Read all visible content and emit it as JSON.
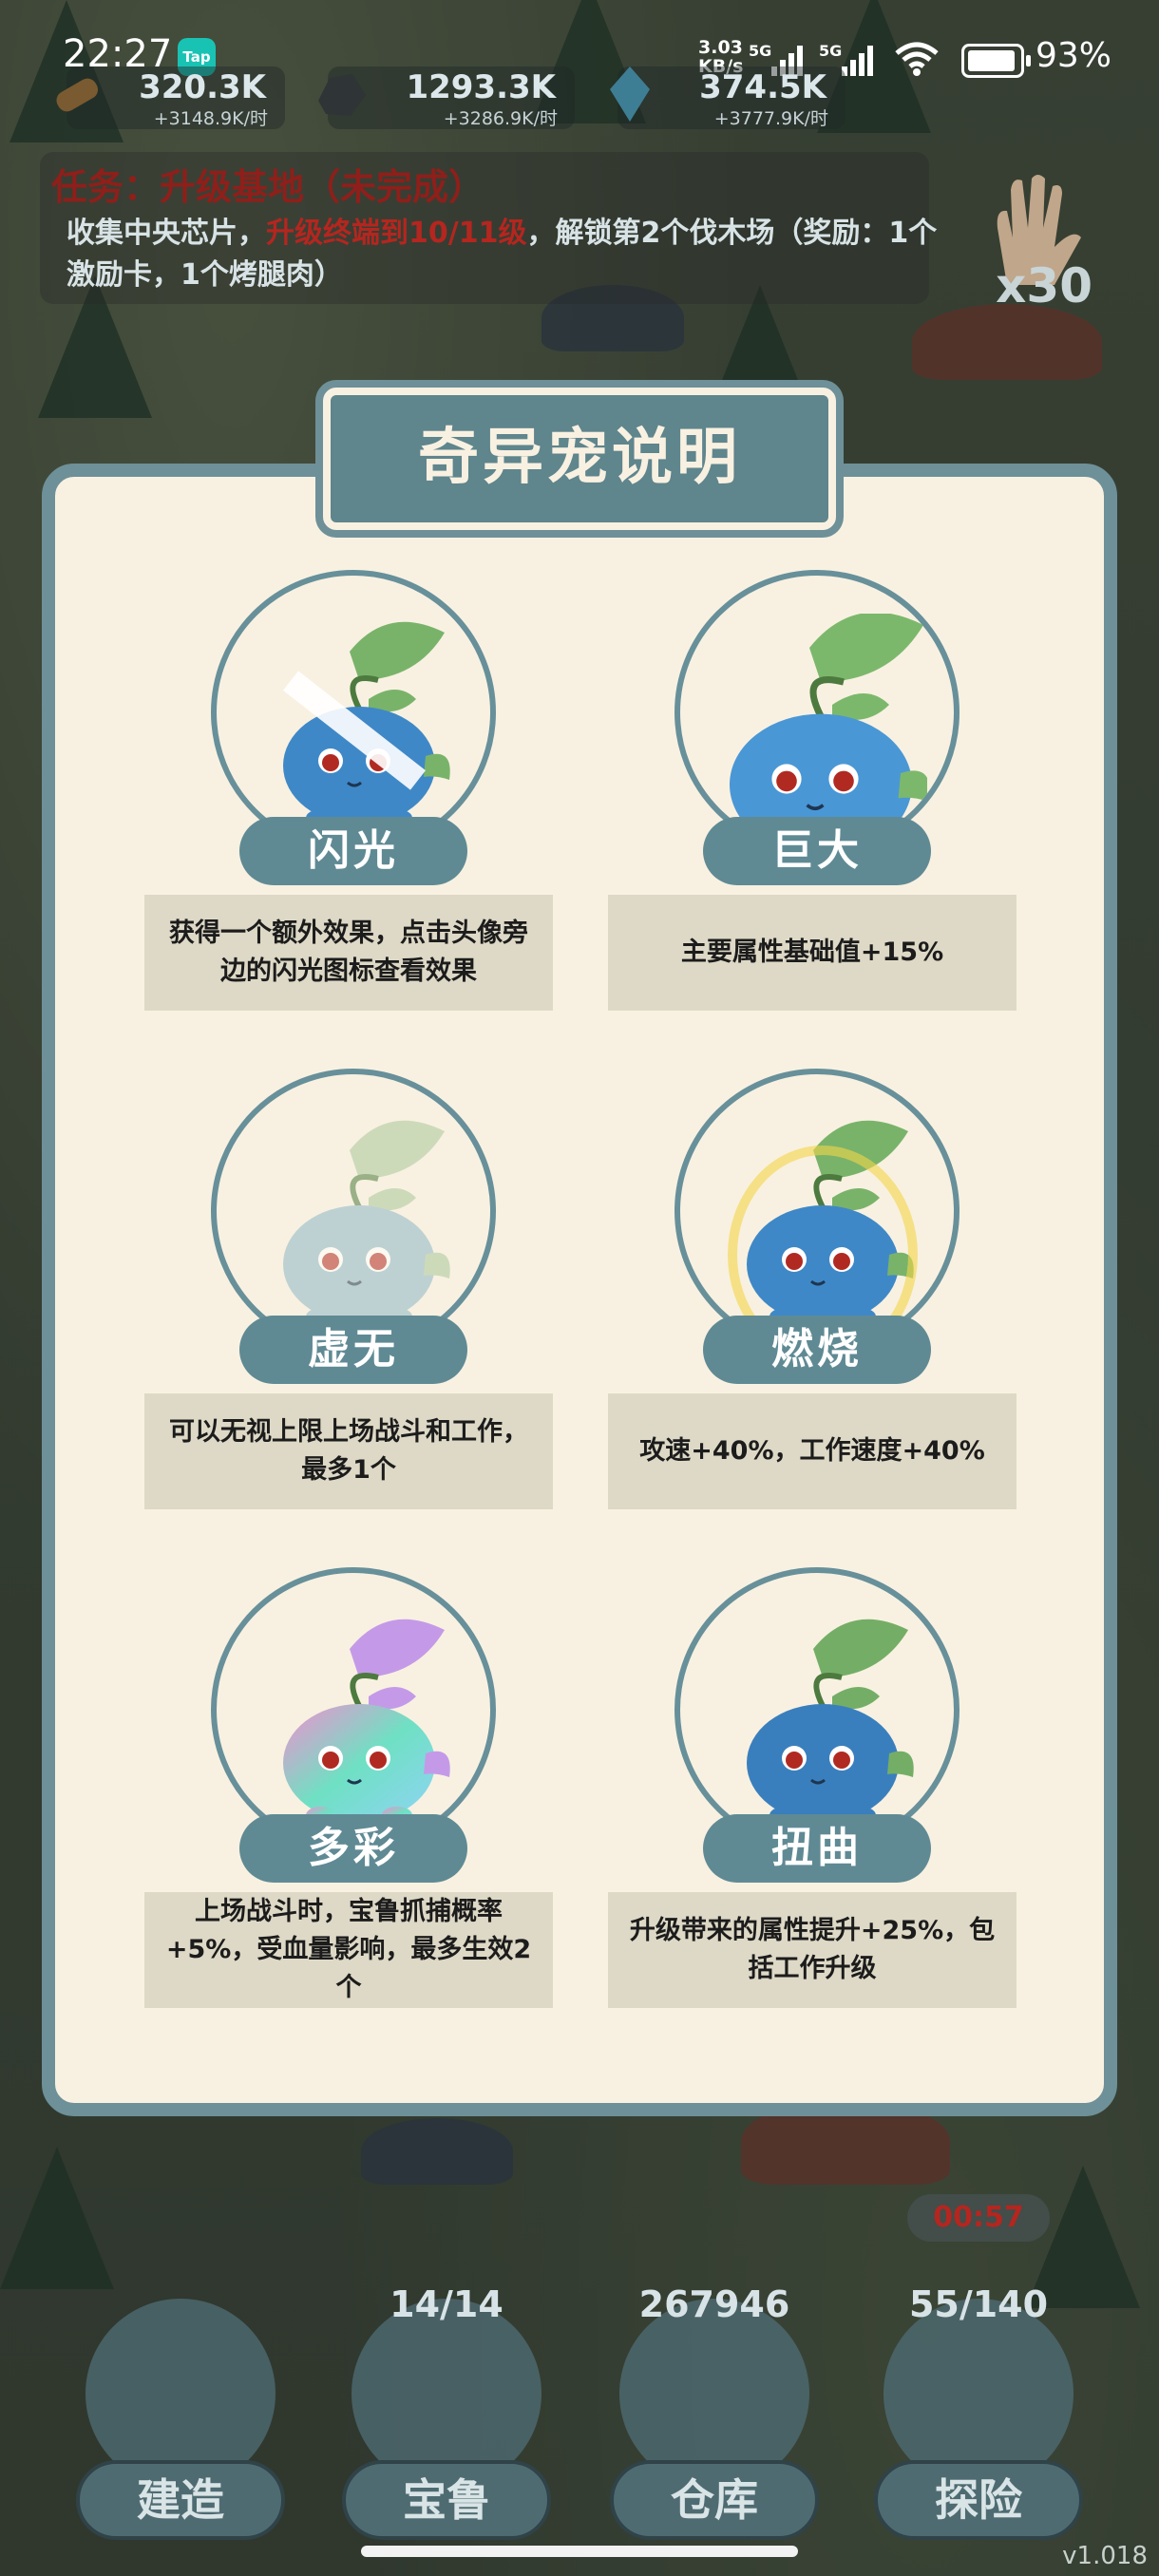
{
  "status_bar": {
    "time": "22:27",
    "app_badge": "Tap",
    "net_speed_top": "3.03",
    "net_speed_bottom": "KB/s",
    "sig1": "5G",
    "sig2": "5G",
    "battery_pct": "93%",
    "battery_level": 0.93
  },
  "resources": [
    {
      "value": "320.3K",
      "rate": "+3148.9K/时",
      "icon": "wood-log-icon"
    },
    {
      "value": "1293.3K",
      "rate": "+3286.9K/时",
      "icon": "stone-ore-icon"
    },
    {
      "value": "374.5K",
      "rate": "+3777.9K/时",
      "icon": "crystal-icon"
    }
  ],
  "task": {
    "title": "任务：升级基地（未完成）",
    "desc_a": "收集中央芯片，",
    "desc_highlight": "升级终端到10/11级",
    "desc_b": "，解锁第2个伐木场（奖励：1个激励卡，1个烤腿肉）"
  },
  "side_item": {
    "count": "x30",
    "icon": "hand-icon"
  },
  "modal": {
    "title": "奇异宠说明",
    "pets": [
      {
        "label": "闪光",
        "desc": "获得一个额外效果，点击头像旁边的闪光图标查看效果",
        "variant": "flash"
      },
      {
        "label": "巨大",
        "desc": "主要属性基础值+15%",
        "variant": "giant"
      },
      {
        "label": "虚无",
        "desc": "可以无视上限上场战斗和工作，最多1个",
        "variant": "void"
      },
      {
        "label": "燃烧",
        "desc": "攻速+40%，工作速度+40%",
        "variant": "burn"
      },
      {
        "label": "多彩",
        "desc": "上场战斗时，宝鲁抓捕概率+5%，受血量影响，最多生效2个",
        "variant": "rainbow"
      },
      {
        "label": "扭曲",
        "desc": "升级带来的属性提升+25%，包括工作升级",
        "variant": "twist"
      }
    ]
  },
  "bottom_nav": {
    "timer": "00:57",
    "items": [
      {
        "label": "建造",
        "count": "",
        "icon": "build-house-icon"
      },
      {
        "label": "宝鲁",
        "count": "14/14",
        "icon": "pet-icon"
      },
      {
        "label": "仓库",
        "count": "267946",
        "icon": "chest-icon"
      },
      {
        "label": "探险",
        "count": "55/140",
        "icon": "explore-icon"
      }
    ]
  },
  "version": "v1.018",
  "colors": {
    "accent": "#5f8a94",
    "panel": "#f8f1e1",
    "desc_bg": "#ded9c6",
    "alert": "#b4261f"
  }
}
